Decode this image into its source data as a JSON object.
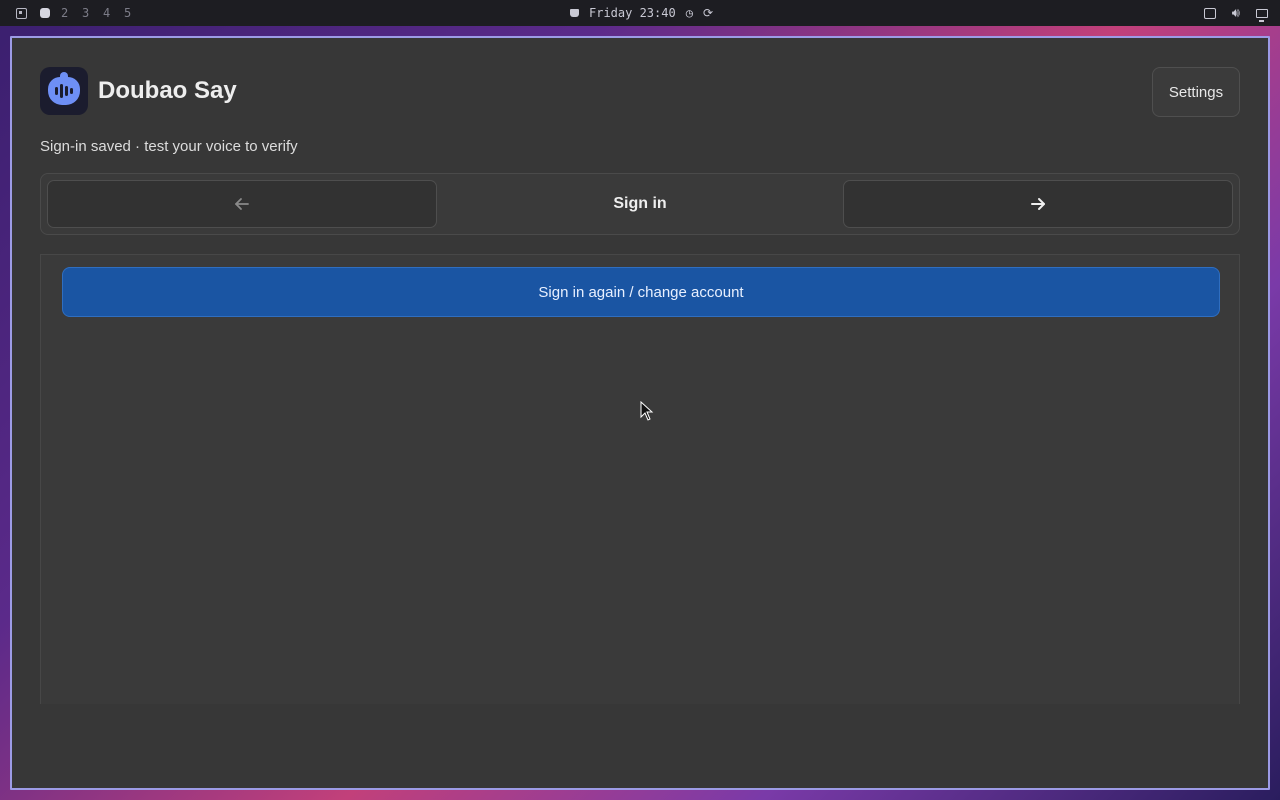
{
  "topbar": {
    "workspaces": [
      "2",
      "3",
      "4",
      "5"
    ],
    "clock": "Friday 23:40",
    "icons": [
      "layout-icon",
      "active-workspace-icon",
      "coffee-icon",
      "timer-icon",
      "refresh-icon",
      "tray-app-icon",
      "volume-icon",
      "display-icon"
    ]
  },
  "app": {
    "title": "Doubao Say",
    "icon": "voice-bubble-icon",
    "settings_label": "Settings",
    "status": "Sign-in saved · test your voice to verify"
  },
  "stepper": {
    "label": "Sign in",
    "prev_icon": "arrow-left-icon",
    "next_icon": "arrow-right-icon"
  },
  "content": {
    "primary_button": "Sign in again / change account"
  },
  "colors": {
    "window_bg": "#373737",
    "primary": "#1a55a3",
    "border_accent": "#9d9be6",
    "app_icon_accent": "#6e8ff5"
  }
}
